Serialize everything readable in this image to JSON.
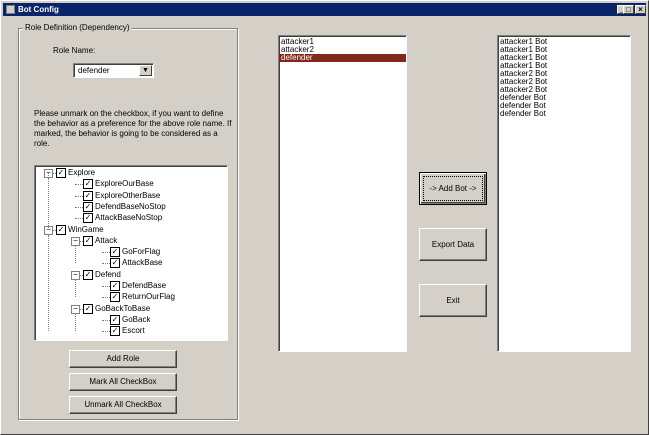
{
  "window": {
    "title": "Bot Config",
    "minimize": "_",
    "maximize": "□",
    "close": "×"
  },
  "role_group": {
    "legend": "Role Definition (Dependency)",
    "role_name_label": "Role Name:",
    "role_name_value": "defender",
    "note": "Please unmark on the checkbox, if you want to define the behavior as a preference for the above role name. If marked, the behavior is going to be considered as a role."
  },
  "tree": {
    "nodes": [
      {
        "label": "Explore",
        "checked": "✓",
        "expander": "−"
      },
      {
        "label": "ExploreOurBase",
        "checked": "✓"
      },
      {
        "label": "ExploreOtherBase",
        "checked": "✓"
      },
      {
        "label": "DefendBaseNoStop",
        "checked": "✓"
      },
      {
        "label": "AttackBaseNoStop",
        "checked": "✓"
      },
      {
        "label": "WinGame",
        "checked": "✓",
        "expander": "−"
      },
      {
        "label": "Attack",
        "checked": "✓",
        "expander": "−"
      },
      {
        "label": "GoForFlag",
        "checked": "✓"
      },
      {
        "label": "AttackBase",
        "checked": "✓"
      },
      {
        "label": "Defend",
        "checked": "✓",
        "expander": "−"
      },
      {
        "label": "DefendBase",
        "checked": "✓"
      },
      {
        "label": "ReturnOurFlag",
        "checked": "✓"
      },
      {
        "label": "GoBackToBase",
        "checked": "✓",
        "expander": "−"
      },
      {
        "label": "GoBack",
        "checked": "✓"
      },
      {
        "label": "Escort",
        "checked": "✓"
      }
    ]
  },
  "buttons": {
    "add_role": "Add Role",
    "mark_all": "Mark All CheckBox",
    "unmark_all": "Unmark All CheckBox",
    "add_bot": "-> Add Bot ->",
    "export_data": "Export Data",
    "exit": "Exit"
  },
  "roles_list": {
    "items": [
      "attacker1",
      "attacker2",
      "defender"
    ],
    "selected": "defender"
  },
  "bots_list": {
    "items": [
      "attacker1 Bot",
      "attacker1 Bot",
      "attacker1 Bot",
      "attacker1 Bot",
      "attacker2 Bot",
      "attacker2 Bot",
      "attacker2 Bot",
      "defender Bot",
      "defender Bot",
      "defender Bot"
    ]
  },
  "colors": {
    "titlebar": "#0a246a",
    "face": "#d4d0c8",
    "selection": "#80281a"
  }
}
